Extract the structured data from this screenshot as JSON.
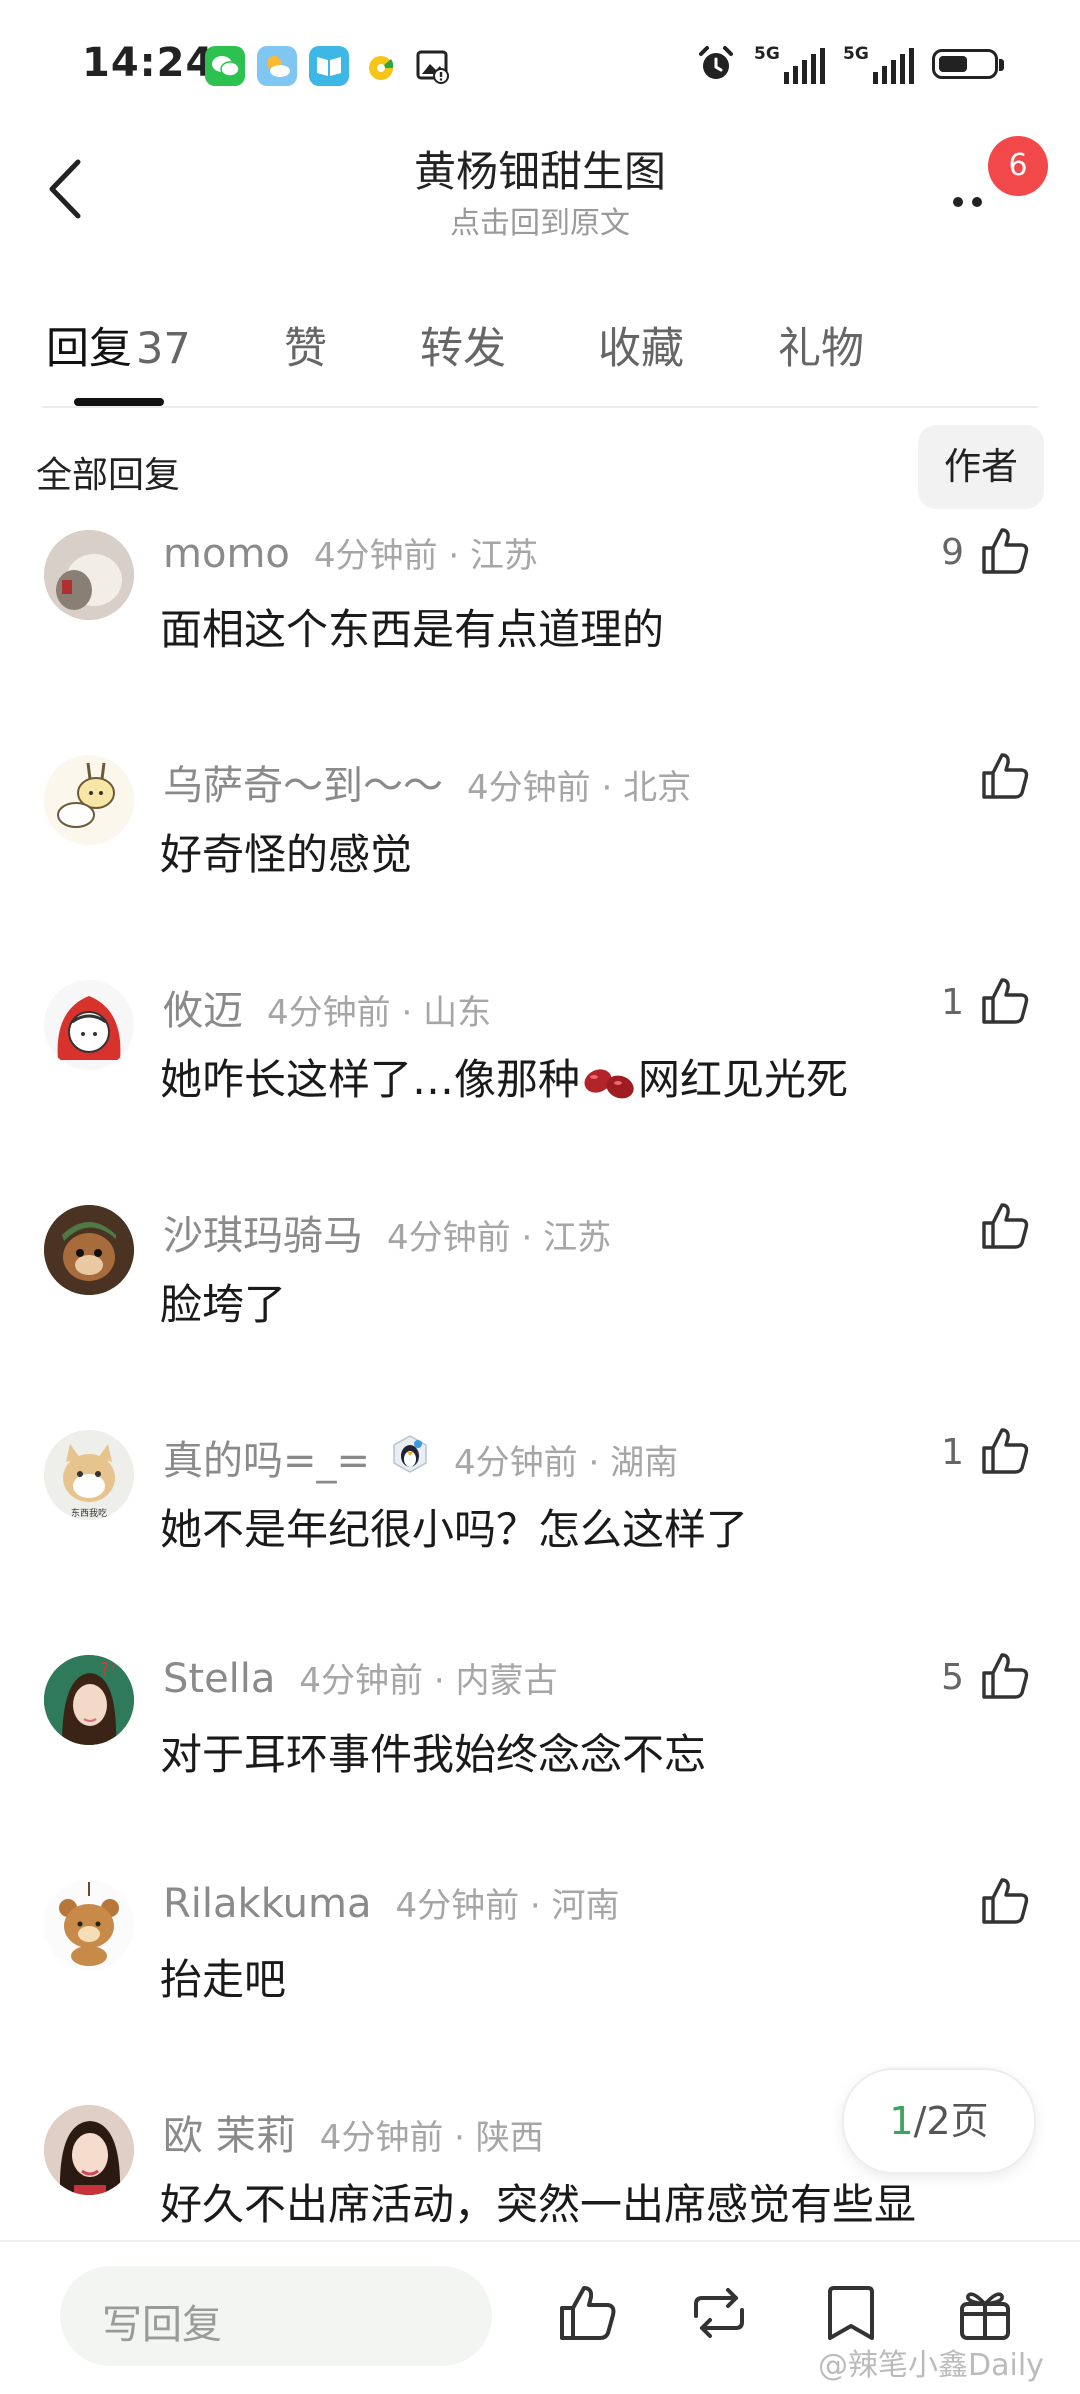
{
  "status": {
    "time": "14:24",
    "net1": "5G",
    "net2": "5G"
  },
  "header": {
    "title": "黄杨钿甜生图",
    "subtitle": "点击回到原文",
    "badge": "6"
  },
  "tabs": [
    {
      "label": "回复",
      "count": "37"
    },
    {
      "label": "赞"
    },
    {
      "label": "转发"
    },
    {
      "label": "收藏"
    },
    {
      "label": "礼物"
    }
  ],
  "filter": {
    "label": "全部回复",
    "author_button": "作者"
  },
  "comments": [
    {
      "user": "momo",
      "time": "4分钟前",
      "loc": "江苏",
      "text": "面相这个东西是有点道理的",
      "likes": "9"
    },
    {
      "user": "乌萨奇～到～～",
      "time": "4分钟前",
      "loc": "北京",
      "text": "好奇怪的感觉",
      "likes": ""
    },
    {
      "user": "攸迈",
      "time": "4分钟前",
      "loc": "山东",
      "text_before": "她咋长这样了…像那种",
      "text_after": "网红见光死",
      "likes": "1"
    },
    {
      "user": "沙琪玛骑马",
      "time": "4分钟前",
      "loc": "江苏",
      "text": "脸垮了",
      "likes": ""
    },
    {
      "user": "真的吗=_=",
      "time": "4分钟前",
      "loc": "湖南",
      "text": "她不是年纪很小吗？怎么这样了",
      "likes": "1"
    },
    {
      "user": "Stella",
      "time": "4分钟前",
      "loc": "内蒙古",
      "text": "对于耳环事件我始终念念不忘",
      "likes": "5"
    },
    {
      "user": "Rilakkuma",
      "time": "4分钟前",
      "loc": "河南",
      "text": "抬走吧",
      "likes": ""
    },
    {
      "user": "欧 茉莉",
      "time": "4分钟前",
      "loc": "陕西",
      "text": "好久不出席活动，突然一出席感觉有些显",
      "likes": ""
    }
  ],
  "pager": {
    "current": "1",
    "rest": "/2页"
  },
  "bottom": {
    "reply_placeholder": "写回复"
  },
  "watermark": "@辣笔小鑫Daily",
  "colors": {
    "accent_green": "#3aa55f",
    "badge_red": "#f2484a"
  }
}
